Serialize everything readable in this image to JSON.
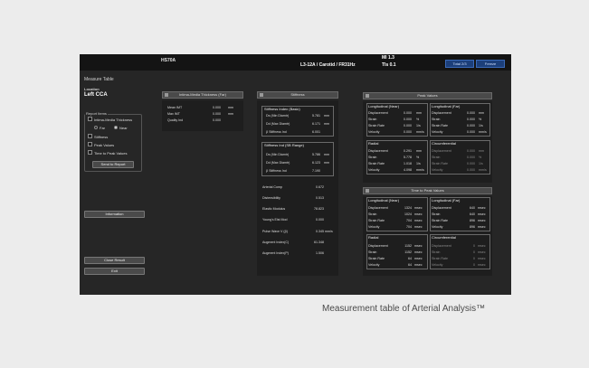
{
  "topbar": {
    "model": "HS70A",
    "mi": "MI  1.3",
    "probe": "L3-12A / Carotid / FR31Hz",
    "tis": "TIs 0.1",
    "buttons": [
      "Total  2/3",
      "Freeze"
    ]
  },
  "left": {
    "title": "Measure Table",
    "location_label": "Location",
    "location_value": "Left CCA",
    "report_items_label": "Report Items",
    "items": [
      "Intima-Media Thickness",
      "Far",
      "Near",
      "Stiffness",
      "Peak Values",
      "Time to Peak Values"
    ],
    "send_button": "Send to Report",
    "information_button": "Information",
    "close_button": "Close Result",
    "exit_button": "Exit"
  },
  "imt": {
    "header": "Intima-Media Thickness (Far)",
    "rows": [
      {
        "label": "Mean IMT",
        "value": "0.000",
        "unit": "mm"
      },
      {
        "label": "Max IMT",
        "value": "0.000",
        "unit": "mm"
      },
      {
        "label": "Quality Ind",
        "value": "0.000",
        "unit": ""
      }
    ]
  },
  "stiffness": {
    "header": "Stiffness",
    "basic_title": "Stiffness Index (Basic)",
    "basic_rows": [
      {
        "label": "Ds (Min Diamtr)",
        "value": "5.781",
        "unit": "mm"
      },
      {
        "label": "Dd (Max Diamtr)",
        "value": "6.171",
        "unit": "mm"
      },
      {
        "label": "β Stiffness Ind",
        "value": "6.001",
        "unit": ""
      }
    ],
    "sb_title": "Stiffness Ind (SB Range)",
    "sb_rows": [
      {
        "label": "Ds (Min Diamtr)",
        "value": "5.786",
        "unit": "mm"
      },
      {
        "label": "Dd (Max Diamtr)",
        "value": "6.123",
        "unit": "mm"
      },
      {
        "label": "β Stiffness Ind",
        "value": "7.190",
        "unit": ""
      }
    ],
    "other_rows": [
      {
        "label": "Arterial Comp",
        "value": "0.672",
        "unit": ""
      },
      {
        "label": "Distensibility",
        "value": "0.513",
        "unit": ""
      },
      {
        "label": "Elastic Modulus",
        "value": "78.823",
        "unit": ""
      },
      {
        "label": "Young's Elst Mod",
        "value": "0.000",
        "unit": ""
      },
      {
        "label": "Pulse Wave V (β)",
        "value": "0.345",
        "unit": "mm/s"
      },
      {
        "label": "Augment Index(C)",
        "value": "61.348",
        "unit": ""
      },
      {
        "label": "Augment Index(P)",
        "value": "1.506",
        "unit": ""
      }
    ]
  },
  "peak": {
    "header": "Peak Values",
    "groups": [
      {
        "title": "Longitudinal (Near)",
        "dim": false,
        "rows": [
          {
            "label": "Displacement",
            "value": "0.000",
            "unit": "mm"
          },
          {
            "label": "Strain",
            "value": "0.000",
            "unit": "%"
          },
          {
            "label": "Strain Rate",
            "value": "0.000",
            "unit": "1/s"
          },
          {
            "label": "Velocity",
            "value": "0.000",
            "unit": "mm/s"
          }
        ]
      },
      {
        "title": "Longitudinal (Far)",
        "dim": false,
        "rows": [
          {
            "label": "Displacement",
            "value": "0.000",
            "unit": "mm"
          },
          {
            "label": "Strain",
            "value": "0.000",
            "unit": "%"
          },
          {
            "label": "Strain Rate",
            "value": "0.000",
            "unit": "1/s"
          },
          {
            "label": "Velocity",
            "value": "0.000",
            "unit": "mm/s"
          }
        ]
      },
      {
        "title": "Radial",
        "dim": false,
        "rows": [
          {
            "label": "Displacement",
            "value": "0.291",
            "unit": "mm"
          },
          {
            "label": "Strain",
            "value": "5.778",
            "unit": "%"
          },
          {
            "label": "Strain Rate",
            "value": "1.018",
            "unit": "1/s"
          },
          {
            "label": "Velocity",
            "value": "4.098",
            "unit": "mm/s"
          }
        ]
      },
      {
        "title": "Circumferential",
        "dim": true,
        "rows": [
          {
            "label": "Displacement",
            "value": "0.000",
            "unit": "mm"
          },
          {
            "label": "Strain",
            "value": "0.000",
            "unit": "%"
          },
          {
            "label": "Strain Rate",
            "value": "0.000",
            "unit": "1/s"
          },
          {
            "label": "Velocity",
            "value": "0.000",
            "unit": "mm/s"
          }
        ]
      }
    ]
  },
  "ttp": {
    "header": "Time to Peak Values",
    "groups": [
      {
        "title": "Longitudinal (Near)",
        "dim": false,
        "rows": [
          {
            "label": "Displacement",
            "value": "1324",
            "unit": "msec"
          },
          {
            "label": "Strain",
            "value": "1024",
            "unit": "msec"
          },
          {
            "label": "Strain Rate",
            "value": "704",
            "unit": "msec"
          },
          {
            "label": "Velocity",
            "value": "704",
            "unit": "msec"
          }
        ]
      },
      {
        "title": "Longitudinal (Far)",
        "dim": false,
        "rows": [
          {
            "label": "Displacement",
            "value": "640",
            "unit": "msec"
          },
          {
            "label": "Strain",
            "value": "640",
            "unit": "msec"
          },
          {
            "label": "Strain Rate",
            "value": "896",
            "unit": "msec"
          },
          {
            "label": "Velocity",
            "value": "896",
            "unit": "msec"
          }
        ]
      },
      {
        "title": "Radial",
        "dim": false,
        "rows": [
          {
            "label": "Displacement",
            "value": "1152",
            "unit": "msec"
          },
          {
            "label": "Strain",
            "value": "1152",
            "unit": "msec"
          },
          {
            "label": "Strain Rate",
            "value": "64",
            "unit": "msec"
          },
          {
            "label": "Velocity",
            "value": "64",
            "unit": "msec"
          }
        ]
      },
      {
        "title": "Circumferential",
        "dim": true,
        "rows": [
          {
            "label": "Displacement",
            "value": "0",
            "unit": "msec"
          },
          {
            "label": "Strain",
            "value": "0",
            "unit": "msec"
          },
          {
            "label": "Strain Rate",
            "value": "0",
            "unit": "msec"
          },
          {
            "label": "Velocity",
            "value": "0",
            "unit": "msec"
          }
        ]
      }
    ]
  },
  "caption": "Measurement table of Arterial Analysis™"
}
